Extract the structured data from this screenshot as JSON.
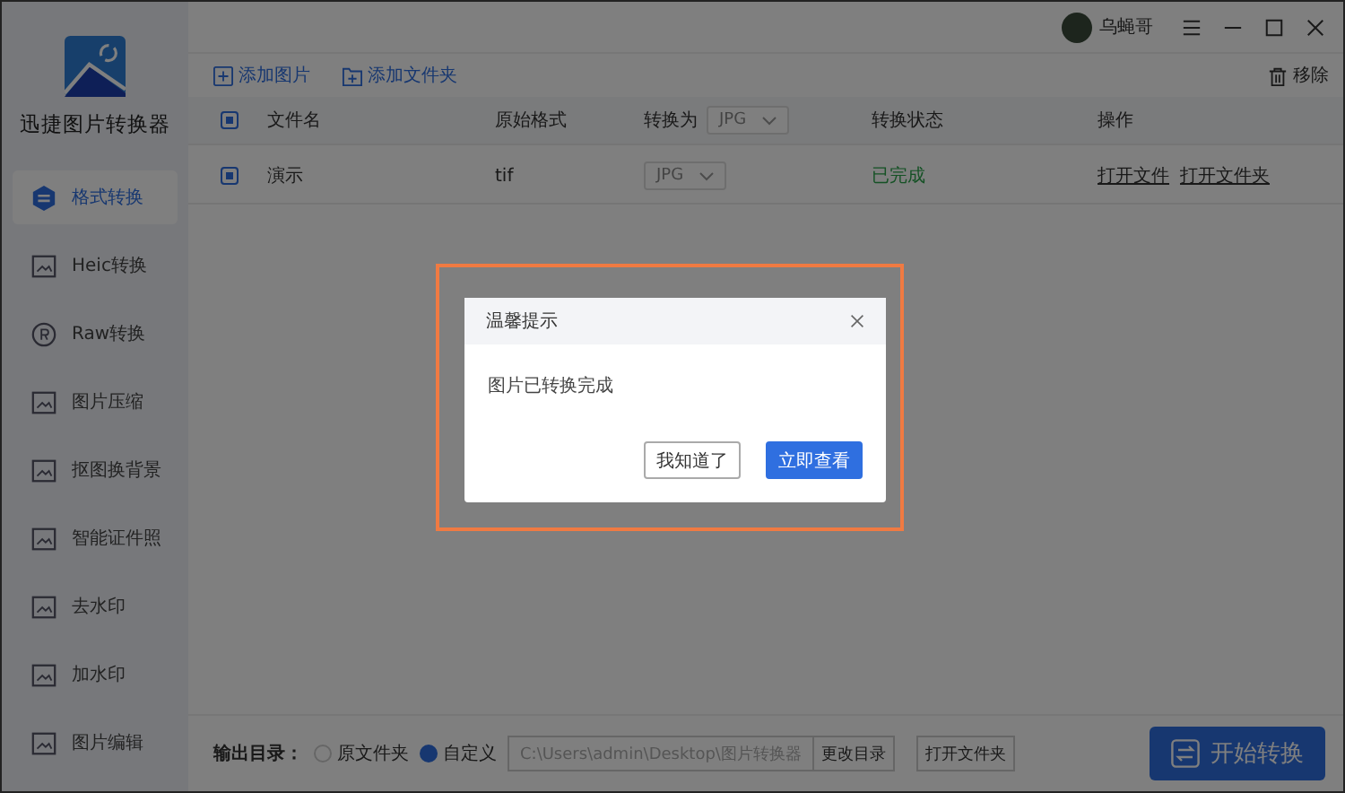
{
  "app": {
    "title": "迅捷图片转换器"
  },
  "user": {
    "name": "乌蝇哥"
  },
  "sidebar": {
    "items": [
      {
        "label": "格式转换",
        "selected": true
      },
      {
        "label": "Heic转换",
        "selected": false
      },
      {
        "label": "Raw转换",
        "selected": false
      },
      {
        "label": "图片压缩",
        "selected": false
      },
      {
        "label": "抠图换背景",
        "selected": false
      },
      {
        "label": "智能证件照",
        "selected": false
      },
      {
        "label": "去水印",
        "selected": false
      },
      {
        "label": "加水印",
        "selected": false
      },
      {
        "label": "图片编辑",
        "selected": false
      }
    ]
  },
  "toolbar": {
    "add_image": "添加图片",
    "add_folder": "添加文件夹",
    "remove": "移除"
  },
  "table": {
    "all_checked": true,
    "columns": [
      "文件名",
      "原始格式",
      "转换为",
      "转换状态",
      "操作"
    ],
    "convert_to_default": "JPG",
    "rows": [
      {
        "checked": true,
        "name": "演示",
        "format": "tif",
        "target": "JPG",
        "status": "已完成",
        "actions": [
          "打开文件",
          "打开文件夹"
        ]
      }
    ]
  },
  "output": {
    "label": "输出目录：",
    "options": [
      {
        "label": "原文件夹",
        "selected": false
      },
      {
        "label": "自定义",
        "selected": true
      }
    ],
    "path": "C:\\Users\\admin\\Desktop\\图片转换器",
    "change_button": "更改目录",
    "open_button": "打开文件夹"
  },
  "start_button": "开始转换",
  "dialog": {
    "title": "温馨提示",
    "message": "图片已转换完成",
    "buttons": [
      {
        "label": "我知道了",
        "kind": "secondary"
      },
      {
        "label": "立即查看",
        "kind": "primary"
      }
    ]
  }
}
